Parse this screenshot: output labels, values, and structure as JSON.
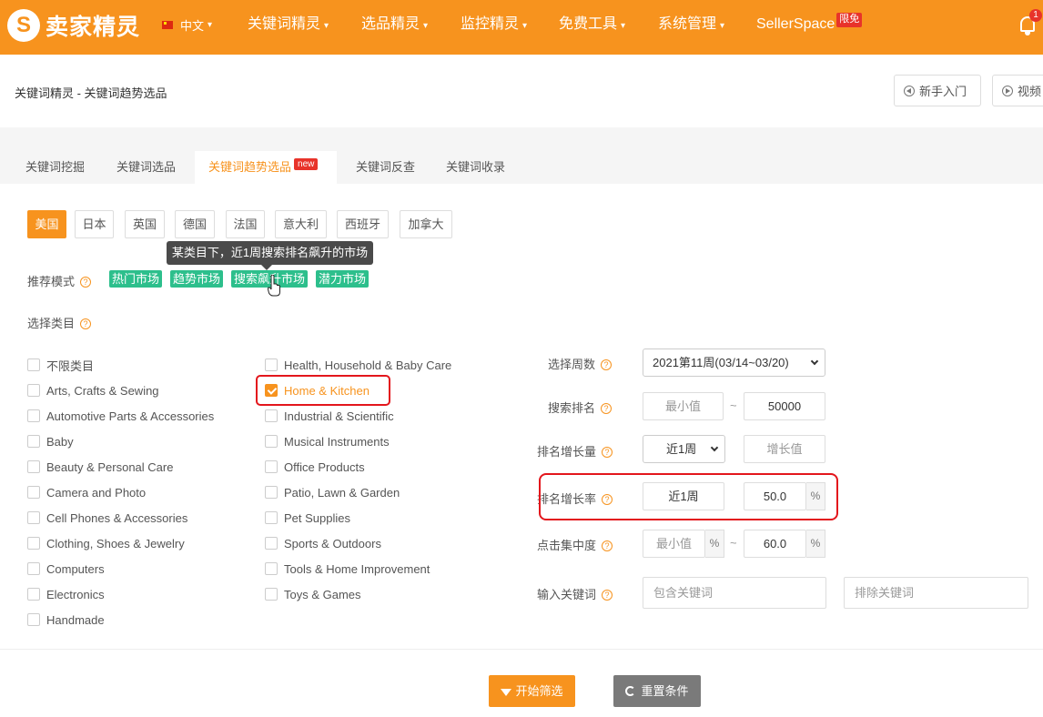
{
  "topbar": {
    "logo_mark": "S",
    "logo_text": "卖家精灵",
    "language": "中文",
    "nav": [
      {
        "label": "关键词精灵"
      },
      {
        "label": "选品精灵"
      },
      {
        "label": "监控精灵"
      },
      {
        "label": "免费工具"
      },
      {
        "label": "系统管理"
      },
      {
        "label": "SellerSpace",
        "badge": "限免"
      }
    ],
    "notification_count": "1",
    "brand_color": "#f7931e"
  },
  "header": {
    "breadcrumb": "关键词精灵 - 关键词趋势选品",
    "beginner_button": "新手入门",
    "video_button": "视频"
  },
  "tabs": [
    {
      "label": "关键词挖掘"
    },
    {
      "label": "关键词选品"
    },
    {
      "label": "关键词趋势选品",
      "badge": "new"
    },
    {
      "label": "关键词反查"
    },
    {
      "label": "关键词收录"
    }
  ],
  "countries": [
    "美国",
    "日本",
    "英国",
    "德国",
    "法国",
    "意大利",
    "西班牙",
    "加拿大"
  ],
  "tooltip": "某类目下，近1周搜索排名飙升的市场",
  "recommend": {
    "label": "推荐模式",
    "modes": [
      "热门市场",
      "趋势市场",
      "搜索飙升市场",
      "潜力市场"
    ]
  },
  "category": {
    "label": "选择类目",
    "column1": [
      "不限类目",
      "Arts, Crafts & Sewing",
      "Automotive Parts & Accessories",
      "Baby",
      "Beauty & Personal Care",
      "Camera and Photo",
      "Cell Phones & Accessories",
      "Clothing, Shoes & Jewelry",
      "Computers",
      "Electronics",
      "Handmade"
    ],
    "column2": [
      "Health, Household & Baby Care",
      "Home & Kitchen",
      "Industrial & Scientific",
      "Musical Instruments",
      "Office Products",
      "Patio, Lawn & Garden",
      "Pet Supplies",
      "Sports & Outdoors",
      "Tools & Home Improvement",
      "Toys & Games"
    ],
    "checked": "Home & Kitchen"
  },
  "filters": {
    "week": {
      "label": "选择周数",
      "value": "2021第11周(03/14~03/20)"
    },
    "search_rank": {
      "label": "搜索排名",
      "min_placeholder": "最小值",
      "max": "50000",
      "separator": "~"
    },
    "rank_growth": {
      "label": "排名增长量",
      "period": "近1周",
      "placeholder": "增长值"
    },
    "rank_growth_rate": {
      "label": "排名增长率",
      "period": "近1周",
      "value": "50.0",
      "unit": "%"
    },
    "click_concentration": {
      "label": "点击集中度",
      "min_placeholder": "最小值",
      "unit": "%",
      "separator": "~",
      "max": "60.0"
    },
    "keyword": {
      "label": "输入关键词",
      "include_placeholder": "包含关键词",
      "exclude_placeholder": "排除关键词"
    }
  },
  "actions": {
    "start": "开始筛选",
    "reset": "重置条件"
  },
  "help_icon": "?"
}
